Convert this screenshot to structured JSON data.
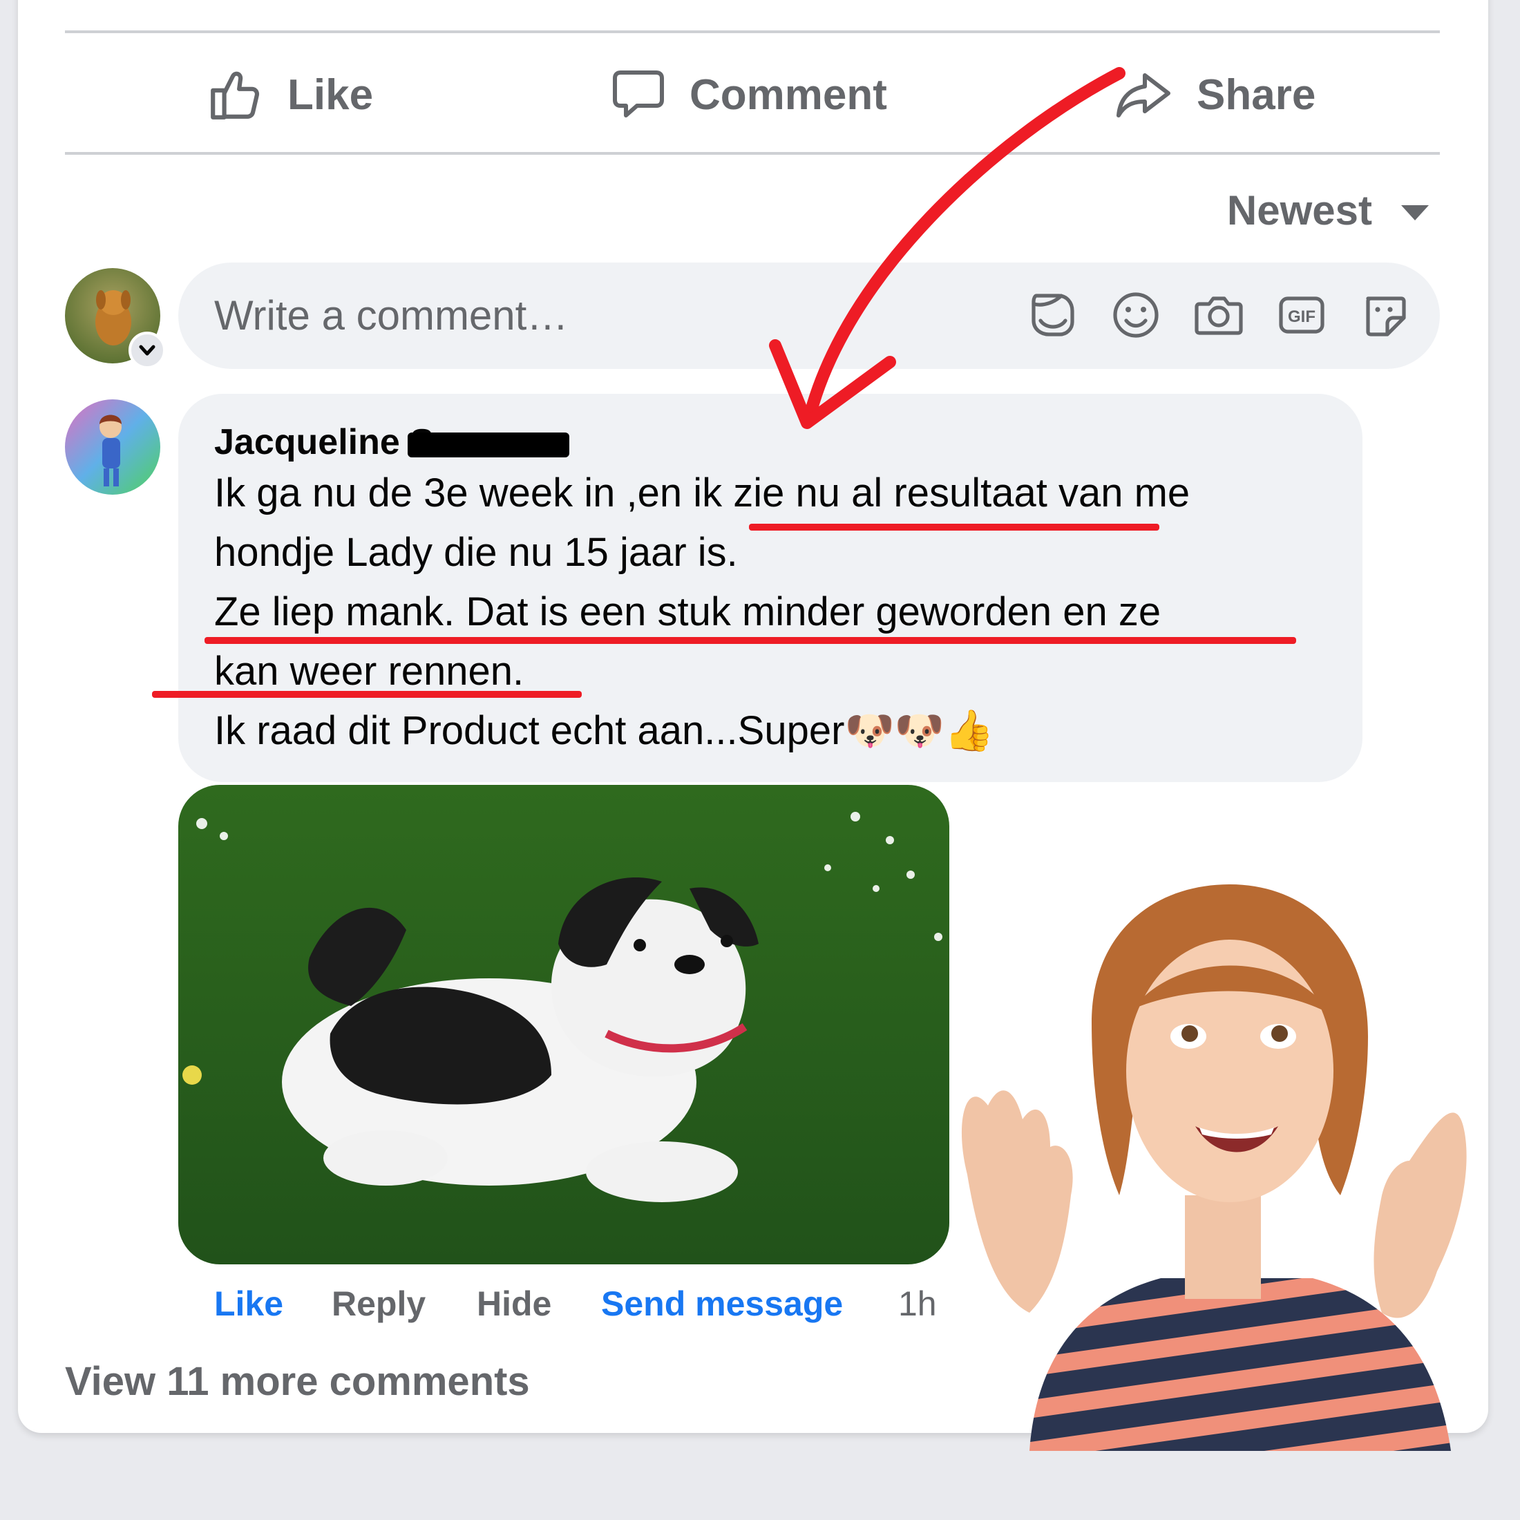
{
  "actions": {
    "like": "Like",
    "comment": "Comment",
    "share": "Share"
  },
  "sort": {
    "label": "Newest"
  },
  "composer": {
    "placeholder": "Write a comment…",
    "tools": [
      "avatar-sticker-icon",
      "emoji-icon",
      "camera-icon",
      "gif-icon",
      "sticker-icon"
    ],
    "gif_label": "GIF"
  },
  "comment": {
    "author": "Jacqueline Sc",
    "lines": [
      "Ik ga nu de 3e week in ,en ik zie nu al resultaat van me",
      "hondje Lady die nu 15 jaar is.",
      "Ze liep mank. Dat is een stuk minder geworden en ze",
      "kan weer rennen.",
      "Ik raad dit Product echt aan...Super"
    ],
    "emoji": "🐶🐶👍",
    "actions": {
      "like": "Like",
      "reply": "Reply",
      "hide": "Hide",
      "send_message": "Send message",
      "time": "1h"
    }
  },
  "view_more": "View 11 more comments",
  "colors": {
    "accent_blue": "#1877f2",
    "annotation_red": "#ee1c25",
    "muted_text": "#65676b",
    "bubble_bg": "#f0f2f5"
  }
}
